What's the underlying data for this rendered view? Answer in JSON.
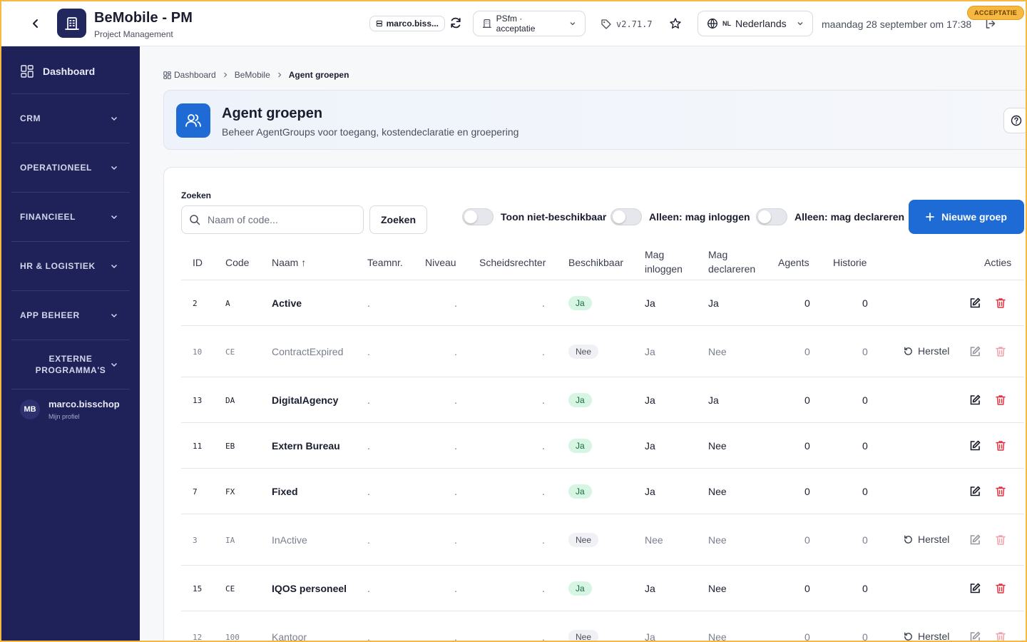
{
  "header": {
    "title": "BeMobile - PM",
    "subtitle": "Project Management",
    "user_chip": "marco.biss...",
    "env_chip": "PSfm · acceptatie",
    "version": "v2.71.7",
    "lang_code": "NL",
    "lang_label": "Nederlands",
    "datetime": "maandag 28 september om 17:38",
    "env_badge": "ACCEPTATIE"
  },
  "sidebar": {
    "dashboard": "Dashboard",
    "sections": [
      "CRM",
      "OPERATIONEEL",
      "FINANCIEEL",
      "HR & LOGISTIEK",
      "APP BEHEER",
      "EXTERNE PROGRAMMA'S"
    ],
    "profile": {
      "initials": "MB",
      "name": "marco.bisschop",
      "sub": "Mijn profiel"
    }
  },
  "breadcrumb": [
    "Dashboard",
    "BeMobile",
    "Agent groepen"
  ],
  "page": {
    "title": "Agent groepen",
    "description": "Beheer AgentGroups voor toegang, kostendeclaratie en groepering"
  },
  "filters": {
    "search_label": "Zoeken",
    "search_placeholder": "Naam of code...",
    "search_button": "Zoeken",
    "toggle_unavailable": "Toon niet-beschikbaar",
    "toggle_login": "Alleen: mag inloggen",
    "toggle_declare": "Alleen: mag declareren",
    "new_button": "Nieuwe groep"
  },
  "table": {
    "columns": [
      "ID",
      "Code",
      "Naam ↑",
      "Teamnr.",
      "Niveau",
      "Scheidsrechter",
      "Beschikbaar",
      "Mag inloggen",
      "Mag declareren",
      "Agents",
      "Historie",
      "Acties"
    ],
    "restore_label": "Herstel",
    "rows": [
      {
        "id": "2",
        "code": "A",
        "name": "Active",
        "team": ".",
        "level": ".",
        "referee": ".",
        "available": "Ja",
        "login": "Ja",
        "declare": "Ja",
        "agents": "0",
        "history": "0",
        "inactive": false
      },
      {
        "id": "10",
        "code": "CE",
        "name": "ContractExpired",
        "team": ".",
        "level": ".",
        "referee": ".",
        "available": "Nee",
        "login": "Ja",
        "declare": "Nee",
        "agents": "0",
        "history": "0",
        "inactive": true
      },
      {
        "id": "13",
        "code": "DA",
        "name": "DigitalAgency",
        "team": ".",
        "level": ".",
        "referee": ".",
        "available": "Ja",
        "login": "Ja",
        "declare": "Ja",
        "agents": "0",
        "history": "0",
        "inactive": false
      },
      {
        "id": "11",
        "code": "EB",
        "name": "Extern Bureau",
        "team": ".",
        "level": ".",
        "referee": ".",
        "available": "Ja",
        "login": "Ja",
        "declare": "Nee",
        "agents": "0",
        "history": "0",
        "inactive": false
      },
      {
        "id": "7",
        "code": "FX",
        "name": "Fixed",
        "team": ".",
        "level": ".",
        "referee": ".",
        "available": "Ja",
        "login": "Ja",
        "declare": "Nee",
        "agents": "0",
        "history": "0",
        "inactive": false
      },
      {
        "id": "3",
        "code": "IA",
        "name": "InActive",
        "team": ".",
        "level": ".",
        "referee": ".",
        "available": "Nee",
        "login": "Nee",
        "declare": "Nee",
        "agents": "0",
        "history": "0",
        "inactive": true
      },
      {
        "id": "15",
        "code": "CE",
        "name": "IQOS personeel",
        "team": ".",
        "level": ".",
        "referee": ".",
        "available": "Ja",
        "login": "Ja",
        "declare": "Nee",
        "agents": "0",
        "history": "0",
        "inactive": false
      },
      {
        "id": "12",
        "code": "100",
        "name": "Kantoor",
        "team": ".",
        "level": ".",
        "referee": ".",
        "available": "Nee",
        "login": "Ja",
        "declare": "Nee",
        "agents": "0",
        "history": "0",
        "inactive": true
      }
    ]
  },
  "colors": {
    "sidebar": "#1f2258",
    "accent": "#1f6bd6",
    "badge": "#f5b942"
  },
  "icons": [
    "back-icon",
    "building-icon",
    "server-icon",
    "refresh-icon",
    "tag-icon",
    "star-icon",
    "globe-icon",
    "logout-icon",
    "grid-icon",
    "users-icon",
    "help-icon",
    "search-icon",
    "plus-icon",
    "edit-icon",
    "trash-icon",
    "restore-icon"
  ]
}
